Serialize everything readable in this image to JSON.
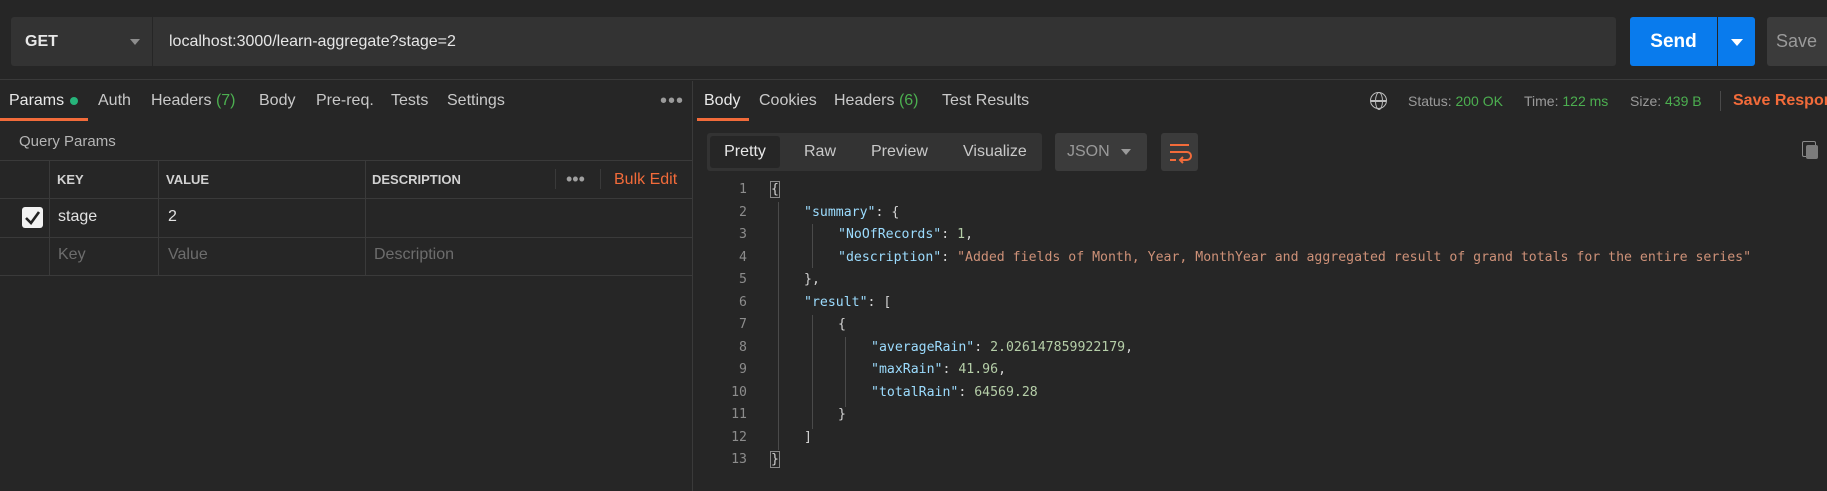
{
  "request": {
    "method": "GET",
    "url": "localhost:3000/learn-aggregate?stage=2",
    "send_label": "Send",
    "save_label": "Save"
  },
  "request_tabs": [
    {
      "label": "Params"
    },
    {
      "label": "Auth"
    },
    {
      "label": "Headers",
      "count": "(7)"
    },
    {
      "label": "Body"
    },
    {
      "label": "Pre-req."
    },
    {
      "label": "Tests"
    },
    {
      "label": "Settings"
    }
  ],
  "query_params": {
    "title": "Query Params",
    "columns": [
      "KEY",
      "VALUE",
      "DESCRIPTION"
    ],
    "bulk_edit": "Bulk Edit",
    "rows": [
      {
        "checked": true,
        "key": "stage",
        "value": "2",
        "description": ""
      }
    ],
    "placeholders": {
      "key": "Key",
      "value": "Value",
      "description": "Description"
    }
  },
  "response_tabs": [
    {
      "label": "Body"
    },
    {
      "label": "Cookies"
    },
    {
      "label": "Headers",
      "count": "(6)"
    },
    {
      "label": "Test Results"
    }
  ],
  "response_meta": {
    "status_label": "Status:",
    "status_value": "200 OK",
    "time_label": "Time:",
    "time_value": "122 ms",
    "size_label": "Size:",
    "size_value": "439 B",
    "save_response": "Save Response"
  },
  "view_tabs": [
    {
      "label": "Pretty"
    },
    {
      "label": "Raw"
    },
    {
      "label": "Preview"
    },
    {
      "label": "Visualize"
    }
  ],
  "format": "JSON",
  "code_lines": [
    "1",
    "2",
    "3",
    "4",
    "5",
    "6",
    "7",
    "8",
    "9",
    "10",
    "11",
    "12",
    "13"
  ],
  "code": {
    "summary_key": "\"summary\"",
    "records_key": "\"NoOfRecords\"",
    "records_val": "1",
    "desc_key": "\"description\"",
    "desc_val": "\"Added fields of Month, Year, MonthYear and aggregated result of grand totals for the entire series\"",
    "result_key": "\"result\"",
    "avg_key": "\"averageRain\"",
    "avg_val": "2.026147859922179",
    "max_key": "\"maxRain\"",
    "max_val": "41.96",
    "total_key": "\"totalRain\"",
    "total_val": "64569.28"
  },
  "colors": {
    "accent": "#f26b3a",
    "send": "#097bed",
    "status_ok": "#4caf50"
  },
  "icons": [
    "caret-down-icon",
    "more-icon",
    "check-icon",
    "globe-icon",
    "wrap-lines-icon",
    "copy-icon"
  ]
}
